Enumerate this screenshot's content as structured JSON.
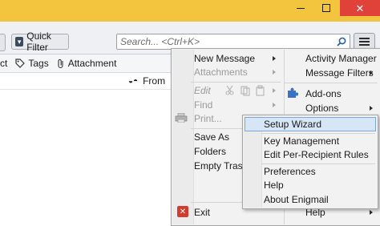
{
  "search": {
    "placeholder": "Search... <Ctrl+K>"
  },
  "toolbar": {
    "quick_filter_label": "Quick Filter"
  },
  "filterbar": {
    "partial_label": "ct",
    "tags_label": "Tags",
    "attachment_label": "Attachment"
  },
  "column_header": {
    "from_label": "From"
  },
  "main_menu": {
    "left": [
      {
        "label": "New Message",
        "disabled": false,
        "submenu": true
      },
      {
        "label": "Attachments",
        "disabled": true,
        "submenu": true
      },
      {
        "label": "Edit",
        "disabled": true,
        "submenu": true
      },
      {
        "label": "Find",
        "disabled": true,
        "submenu": true
      },
      {
        "label": "Print...",
        "disabled": true,
        "submenu": false
      },
      {
        "label": "Save As",
        "disabled": false,
        "submenu": true
      },
      {
        "label": "Folders",
        "disabled": false,
        "submenu": true
      },
      {
        "label": "Empty Trash",
        "disabled": false,
        "submenu": false
      },
      {
        "label": "Exit",
        "disabled": false,
        "submenu": false
      }
    ],
    "right": [
      {
        "label": "Activity Manager",
        "submenu": false
      },
      {
        "label": "Message Filters",
        "submenu": true
      },
      {
        "label": "Add-ons",
        "submenu": false
      },
      {
        "label": "Options",
        "submenu": true
      },
      {
        "label": "Help",
        "submenu": true
      }
    ]
  },
  "enigmail_submenu": {
    "items": [
      "Setup Wizard",
      "Key Management",
      "Edit Per-Recipient Rules",
      "Preferences",
      "Help",
      "About Enigmail"
    ],
    "highlighted": "Setup Wizard"
  },
  "colors": {
    "titlebar": "#f3c53e",
    "close_button": "#e0423a",
    "highlight": "#d6e6f7"
  }
}
